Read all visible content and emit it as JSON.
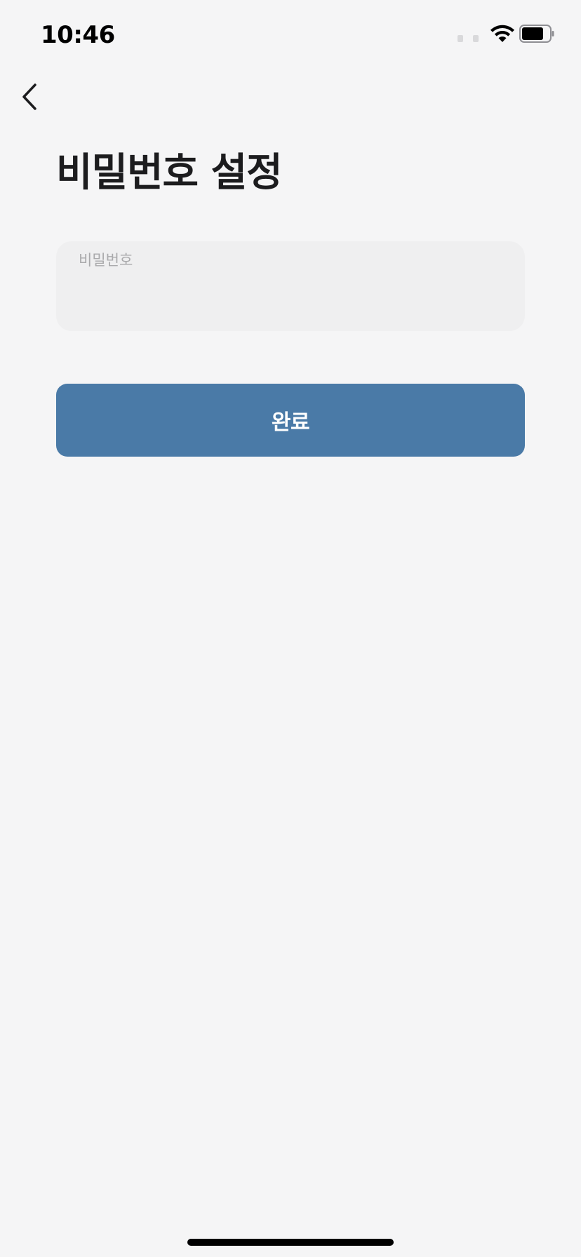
{
  "status_bar": {
    "time": "10:46"
  },
  "header": {
    "back_icon": "chevron-left-icon"
  },
  "main": {
    "title": "비밀번호 설정",
    "password_field": {
      "label": "비밀번호",
      "value": ""
    },
    "submit_button": {
      "label": "완료"
    }
  },
  "colors": {
    "background": "#f5f5f6",
    "field_background": "#efeff0",
    "primary_button": "#4a7aa7",
    "title_text": "#1c1c1e",
    "placeholder_text": "#aaaaac"
  }
}
